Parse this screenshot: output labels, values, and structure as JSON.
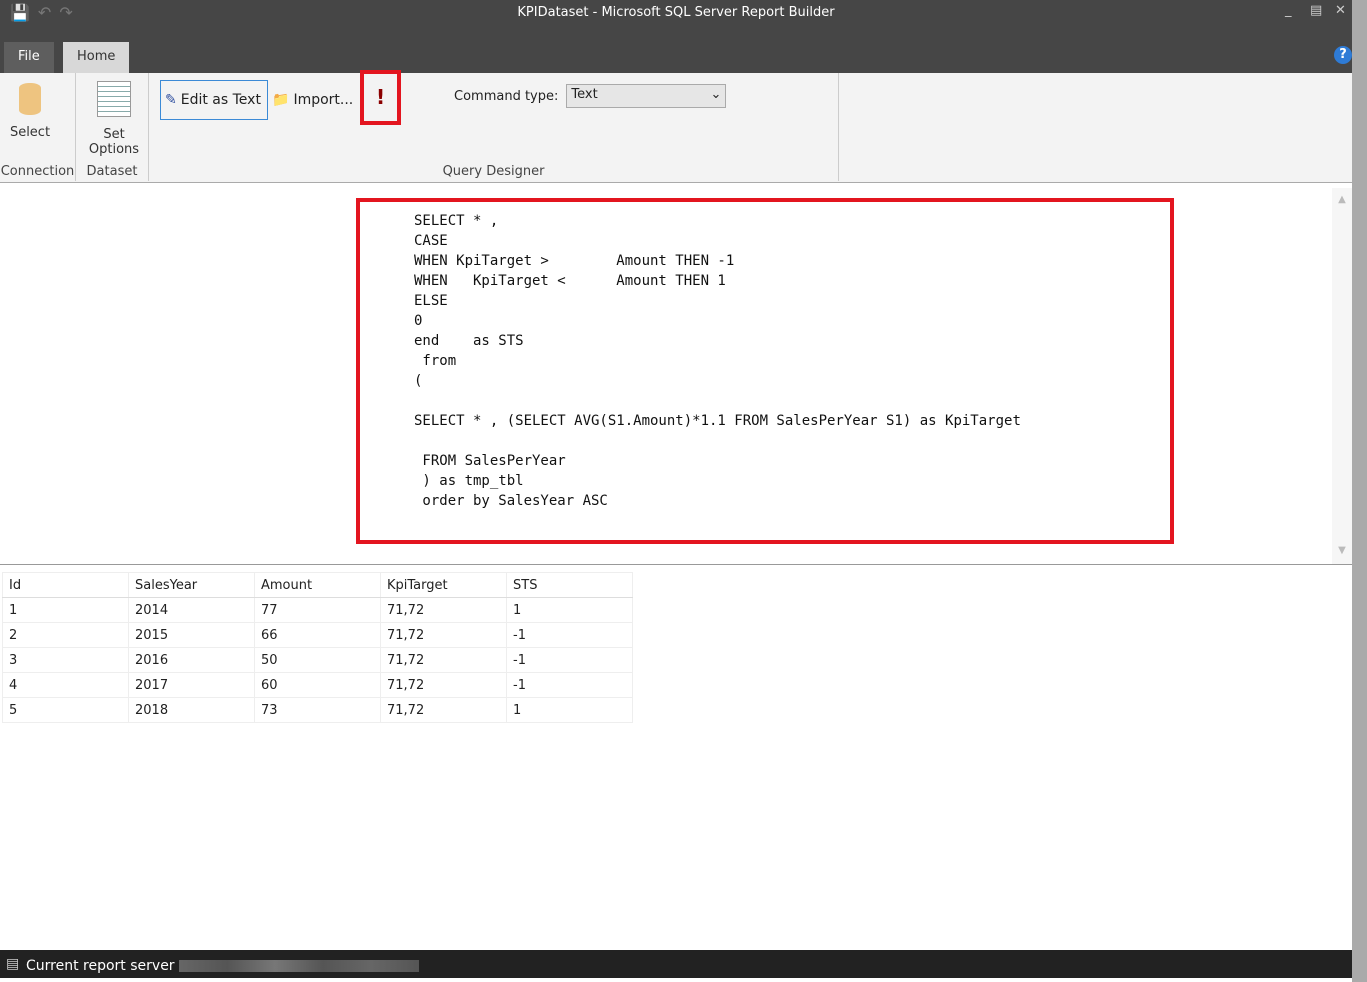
{
  "window": {
    "title": "KPIDataset - Microsoft SQL Server Report Builder"
  },
  "tabs": {
    "file": "File",
    "home": "Home"
  },
  "ribbon": {
    "connection": {
      "select": "Select",
      "group": "Connection"
    },
    "dataset": {
      "set_options_1": "Set",
      "set_options_2": "Options",
      "group": "Dataset"
    },
    "query_designer": {
      "edit_as_text": "Edit as Text",
      "import": "Import...",
      "run": "!",
      "command_type_label": "Command type:",
      "command_type_value": "Text",
      "group": "Query Designer"
    }
  },
  "query": "SELECT * ,\nCASE\nWHEN KpiTarget >        Amount THEN -1\nWHEN   KpiTarget <      Amount THEN 1\nELSE\n0\nend    as STS\n from\n(\n\nSELECT * , (SELECT AVG(S1.Amount)*1.1 FROM SalesPerYear S1) as KpiTarget\n\n FROM SalesPerYear\n ) as tmp_tbl\n order by SalesYear ASC",
  "results": {
    "columns": [
      "Id",
      "SalesYear",
      "Amount",
      "KpiTarget",
      "STS"
    ],
    "rows": [
      [
        "1",
        "2014",
        "77",
        "71,72",
        "1"
      ],
      [
        "2",
        "2015",
        "66",
        "71,72",
        "-1"
      ],
      [
        "3",
        "2016",
        "50",
        "71,72",
        "-1"
      ],
      [
        "4",
        "2017",
        "60",
        "71,72",
        "-1"
      ],
      [
        "5",
        "2018",
        "73",
        "71,72",
        "1"
      ]
    ]
  },
  "status": {
    "label": "Current report server"
  }
}
